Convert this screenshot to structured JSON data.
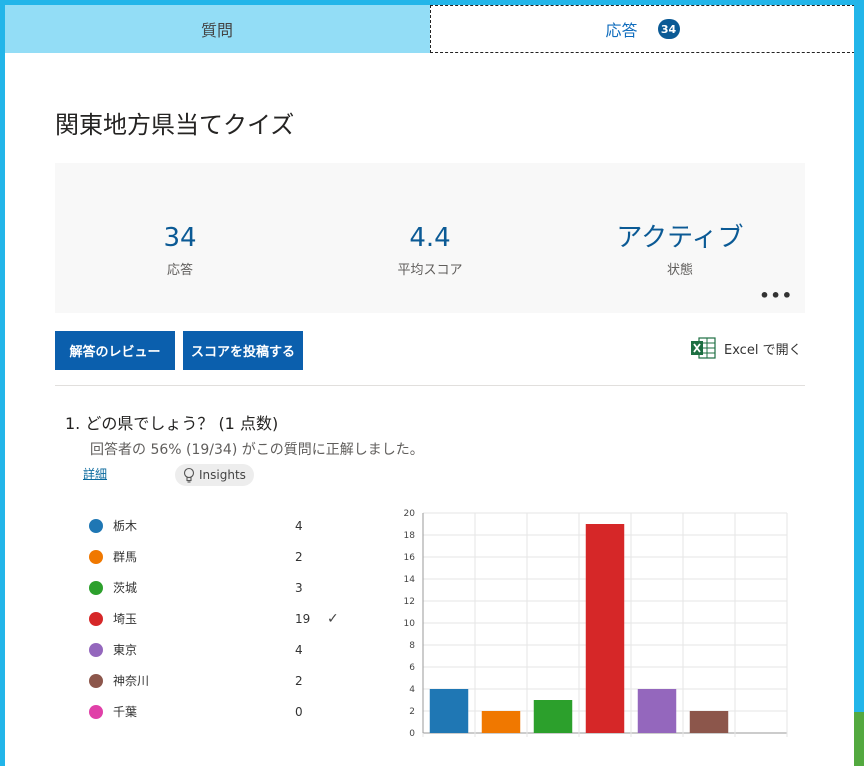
{
  "tabs": [
    {
      "label": "質問"
    },
    {
      "label": "応答",
      "badge": "34"
    }
  ],
  "form_title": "関東地方県当てクイズ",
  "summary": {
    "stats": [
      {
        "value": "34",
        "label": "応答"
      },
      {
        "value": "4.4",
        "label": "平均スコア"
      },
      {
        "value": "アクティブ",
        "label": "状態"
      }
    ],
    "more_label": "•••"
  },
  "actions": {
    "review_label": "解答のレビュー",
    "post_scores_label": "スコアを投稿する",
    "excel_label": "Excel で開く"
  },
  "question": {
    "title": "1.  どの県でしょう？ (1 点数)",
    "subtitle": "回答者の 56% (19/34) がこの質問に正解しました。",
    "details_label": "詳細",
    "insights_label": "Insights"
  },
  "colors": {
    "accent": "#0b5fad",
    "tab_inactive": "#93ddf6",
    "frame": "#22b5e9"
  },
  "chart_data": {
    "type": "bar",
    "categories": [
      "栃木",
      "群馬",
      "茨城",
      "埼玉",
      "東京",
      "神奈川",
      "千葉"
    ],
    "values": [
      4,
      2,
      3,
      19,
      4,
      2,
      0
    ],
    "colors": [
      "#1f77b4",
      "#f07800",
      "#2ca02c",
      "#d62728",
      "#9467bd",
      "#8c564b",
      "#e040a8"
    ],
    "correct": [
      false,
      false,
      false,
      true,
      false,
      false,
      false
    ],
    "check_mark": "✓",
    "ylim": [
      0,
      20
    ],
    "yticks": [
      0,
      2,
      4,
      6,
      8,
      10,
      12,
      14,
      16,
      18,
      20
    ],
    "grid": true,
    "legend_position": "left"
  }
}
